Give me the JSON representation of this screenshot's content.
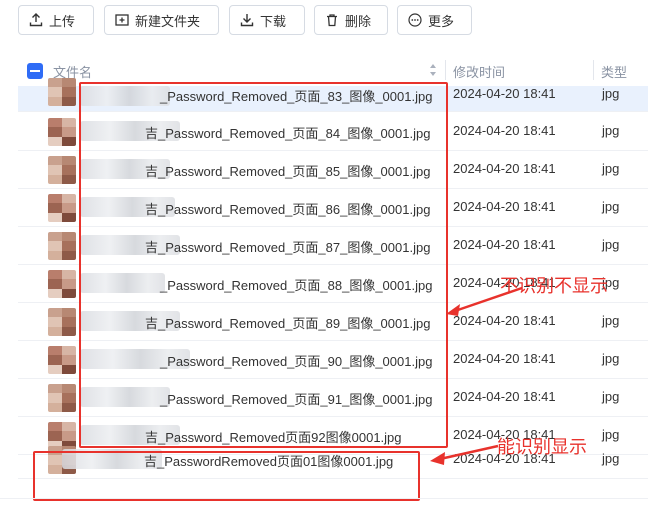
{
  "toolbar": {
    "upload": "上传",
    "new_folder": "新建文件夹",
    "download": "下载",
    "delete": "删除",
    "more": "更多"
  },
  "table": {
    "col_name": "文件名",
    "col_modified": "修改时间",
    "col_type": "类型",
    "rows": [
      {
        "name": "_Password_Removed_页面_83_图像_0001.jpg",
        "modified": "2024-04-20 18:41",
        "type": "jpg"
      },
      {
        "name": "吉_Password_Removed_页面_84_图像_0001.jpg",
        "modified": "2024-04-20 18:41",
        "type": "jpg"
      },
      {
        "name": "吉_Password_Removed_页面_85_图像_0001.jpg",
        "modified": "2024-04-20 18:41",
        "type": "jpg"
      },
      {
        "name": "吉_Password_Removed_页面_86_图像_0001.jpg",
        "modified": "2024-04-20 18:41",
        "type": "jpg"
      },
      {
        "name": "吉_Password_Removed_页面_87_图像_0001.jpg",
        "modified": "2024-04-20 18:41",
        "type": "jpg"
      },
      {
        "name": "_Password_Removed_页面_88_图像_0001.jpg",
        "modified": "2024-04-20 18:41",
        "type": "jpg"
      },
      {
        "name": "吉_Password_Removed_页面_89_图像_0001.jpg",
        "modified": "2024-04-20 18:41",
        "type": "jpg"
      },
      {
        "name": "_Password_Removed_页面_90_图像_0001.jpg",
        "modified": "2024-04-20 18:41",
        "type": "jpg"
      },
      {
        "name": "_Password_Removed_页面_91_图像_0001.jpg",
        "modified": "2024-04-20 18:41",
        "type": "jpg"
      },
      {
        "name": "吉_Password_Removed页面92图像0001.jpg",
        "modified": "2024-04-20 18:41",
        "type": "jpg"
      },
      {
        "name": "吉_PasswordRemoved页面01图像0001.jpg",
        "modified": "2024-04-20 18:41",
        "type": "jpg"
      }
    ]
  },
  "annotations": {
    "not_shown": "不识别不显示",
    "shown": "能识别显示"
  },
  "colors": {
    "accent": "#2f6cf6",
    "annotation_red": "#e8322c",
    "selected_row": "#e9f1fd"
  }
}
